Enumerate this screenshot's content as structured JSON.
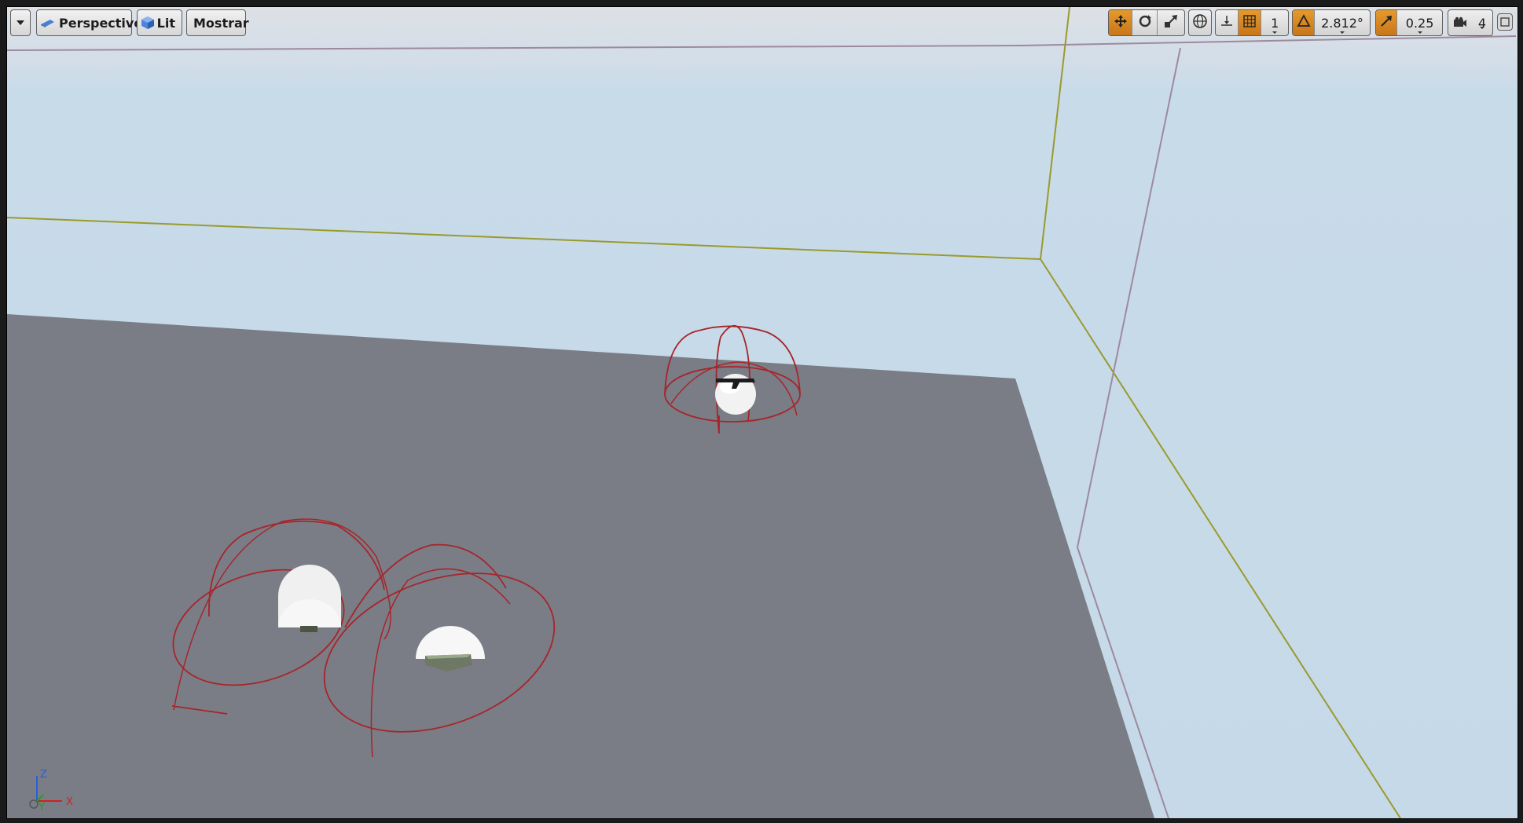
{
  "toolbar": {
    "menu_icon": "chevron-down-icon",
    "perspective_label": "Perspective",
    "lit_label": "Lit",
    "show_label": "Mostrar"
  },
  "transform": {
    "grid_snap_value": "1",
    "rotation_snap_value": "2.812°",
    "scale_snap_value": "0.25",
    "camera_speed_value": "4"
  },
  "axes": {
    "z_label": "Z",
    "x_label": "X",
    "y_label": "Y"
  },
  "colors": {
    "active_orange": "#d8871f",
    "ground": "#7a7d86",
    "sky": "#c8dbe9",
    "wire_red": "#a8242a",
    "guide_olive": "#9a9a2c",
    "guide_mauve": "#9a8a9a"
  }
}
